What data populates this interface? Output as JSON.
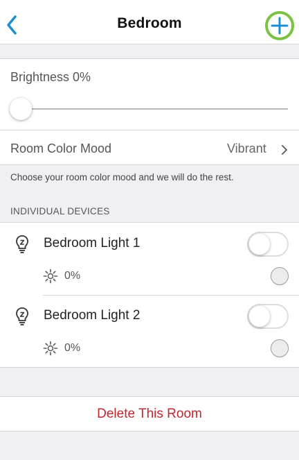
{
  "header": {
    "title": "Bedroom",
    "back_icon": "chevron-left-icon",
    "add_icon": "plus-circle-icon"
  },
  "colors": {
    "accent_blue": "#1a8fd4",
    "add_ring_green": "#7cc242",
    "delete_red": "#c0272d"
  },
  "brightness": {
    "label": "Brightness 0%",
    "value_percent": 0
  },
  "mood": {
    "label": "Room Color Mood",
    "value": "Vibrant",
    "help_text": "Choose your room color mood and we will do the rest."
  },
  "devices": {
    "header": "INDIVIDUAL DEVICES",
    "items": [
      {
        "name": "Bedroom Light 1",
        "brightness_text": "0%",
        "on": false,
        "selected": false
      },
      {
        "name": "Bedroom Light 2",
        "brightness_text": "0%",
        "on": false,
        "selected": false
      }
    ]
  },
  "actions": {
    "delete_label": "Delete This Room"
  }
}
